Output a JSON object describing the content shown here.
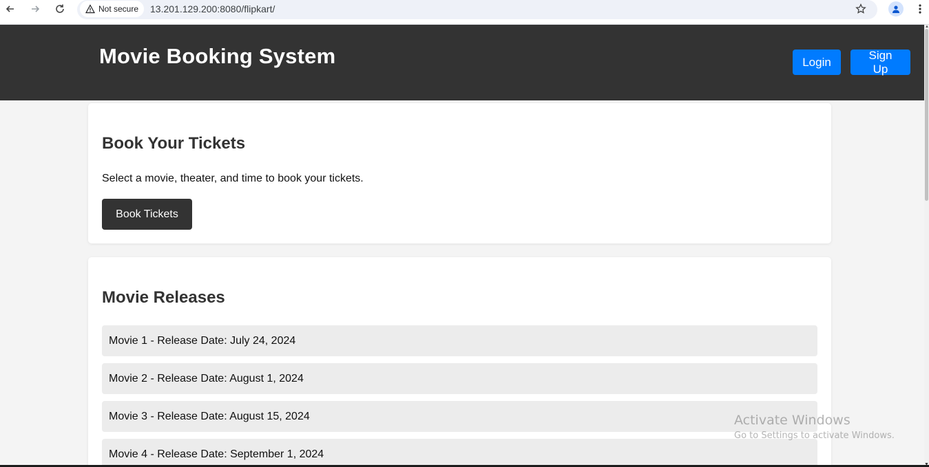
{
  "browser": {
    "security_label": "Not secure",
    "url": "13.201.129.200:8080/flipkart/"
  },
  "header": {
    "title": "Movie Booking System",
    "login_label": "Login",
    "signup_label": "Sign Up"
  },
  "booking": {
    "heading": "Book Your Tickets",
    "description": "Select a movie, theater, and time to book your tickets.",
    "button_label": "Book Tickets"
  },
  "releases": {
    "heading": "Movie Releases",
    "items": [
      {
        "label": "Movie 1 - Release Date: July 24, 2024"
      },
      {
        "label": "Movie 2 - Release Date: August 1, 2024"
      },
      {
        "label": "Movie 3 - Release Date: August 15, 2024"
      },
      {
        "label": "Movie 4 - Release Date: September 1, 2024"
      }
    ]
  },
  "watermark": {
    "title": "Activate Windows",
    "subtitle": "Go to Settings to activate Windows."
  },
  "colors": {
    "header_bg": "#333333",
    "primary_button": "#007bff",
    "dark_button": "#333333",
    "list_item_bg": "#ececec"
  }
}
